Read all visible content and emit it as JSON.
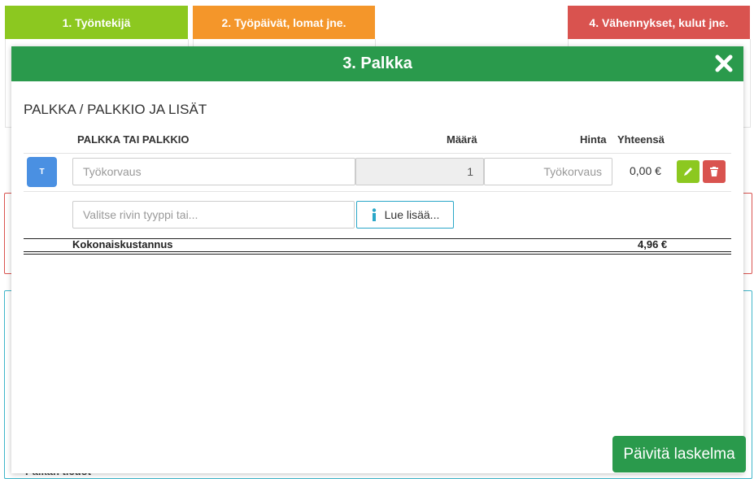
{
  "tabs": [
    {
      "label": "1. Työntekijä",
      "color": "#8cc820"
    },
    {
      "label": "2. Työpäivät, lomat jne.",
      "color": "#f4962a"
    },
    {
      "label": "4. Vähennykset, kulut jne.",
      "color": "#d9534f"
    }
  ],
  "background": {
    "under_text": "Palkan tiedot"
  },
  "modal": {
    "title": "3. Palkka",
    "section_title": "PALKKA / PALKKIO JA LISÄT",
    "columns": {
      "salary": "PALKKA TAI PALKKIO",
      "quantity": "Määrä",
      "price": "Hinta",
      "total": "Yhteensä"
    },
    "row": {
      "badge": "T",
      "description_placeholder": "Työkorvaus",
      "quantity": "1",
      "price_placeholder": "Työkorvaus",
      "total": "0,00 €"
    },
    "new_row": {
      "type_placeholder": "Valitse rivin tyyppi tai...",
      "info_button": "Lue lisää..."
    },
    "summary": {
      "label": "Kokonaiskustannus",
      "value": "4,96 €"
    }
  },
  "update_button": "Päivitä laskelma",
  "colors": {
    "header_green": "#2a9a4c",
    "edit_green": "#8cc820",
    "delete_red": "#d9534f",
    "badge_blue": "#4a90e2",
    "info_teal": "#2aa7c8"
  }
}
